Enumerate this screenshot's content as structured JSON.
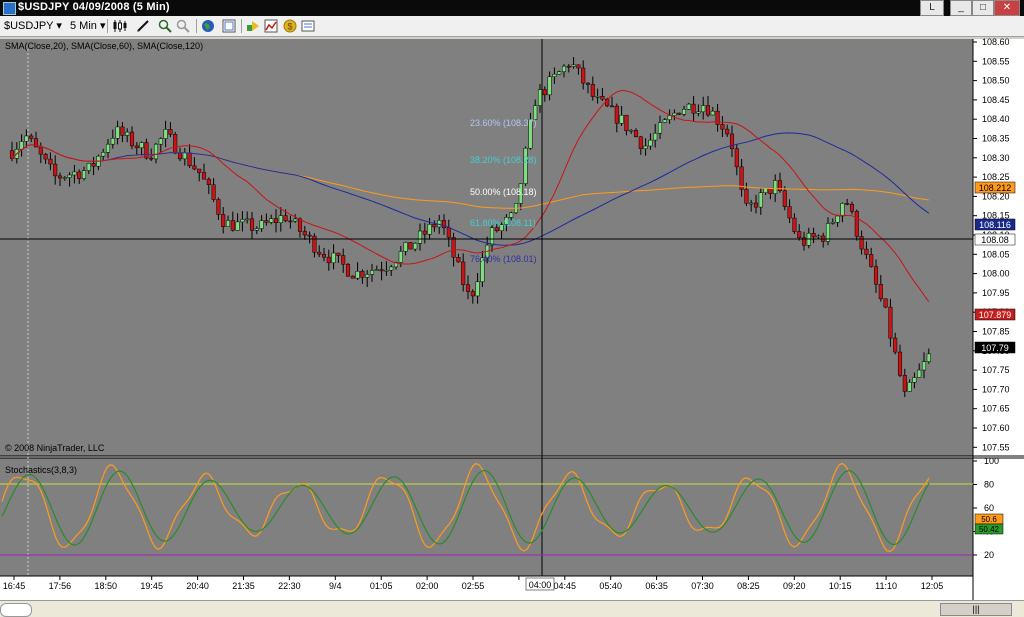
{
  "window": {
    "title": "$USDJPY  04/09/2008 (5 Min)",
    "btn_restore": "L",
    "btn_min": "_",
    "btn_max": "□",
    "btn_close": "✕"
  },
  "toolbar": {
    "instrument": "$USDJPY",
    "interval": "5 Min",
    "dropdown_glyph": "▾"
  },
  "icons": [
    "bar-type-icon",
    "drawing-tool-icon",
    "zoom-in-icon",
    "zoom-out-icon",
    "globe-icon",
    "properties-icon",
    "strategy-icon",
    "indicator-icon",
    "coin-icon",
    "data-box-icon"
  ],
  "main_panel": {
    "indicator_label": "SMA(Close,20), SMA(Close,60), SMA(Close,120)",
    "copyright": "© 2008 NinjaTrader, LLC",
    "y_ticks": [
      "108.60",
      "108.55",
      "108.50",
      "108.45",
      "108.40",
      "108.35",
      "108.30",
      "108.25",
      "108.20",
      "108.15",
      "108.10",
      "108.05",
      "108.00",
      "107.95",
      "107.90",
      "107.85",
      "107.80",
      "107.75",
      "107.70",
      "107.65",
      "107.60",
      "107.55"
    ],
    "price_tags": [
      {
        "label": "108.212",
        "color": "#ff9a1a",
        "text_color": "#000000"
      },
      {
        "label": "108.116",
        "color": "#1a2a8a",
        "text_color": "#ffffff"
      },
      {
        "label": "108.08",
        "color": "#ffffff",
        "text_color": "#000000"
      },
      {
        "label": "107.879",
        "color": "#c41e1e",
        "text_color": "#ffffff"
      },
      {
        "label": "107.79",
        "color": "#000000",
        "text_color": "#ffffff"
      }
    ],
    "fib_levels": [
      {
        "label": "23.60% (108.37)",
        "color": "#b0c8f0"
      },
      {
        "label": "38.20% (108.28)",
        "color": "#40d0d0"
      },
      {
        "label": "50.00% (108.18)",
        "color": "#ffffff"
      },
      {
        "label": "61.80% (108.11)",
        "color": "#40d0d0"
      },
      {
        "label": "76.40% (108.01)",
        "color": "#3030a0"
      }
    ]
  },
  "stoch_panel": {
    "label": "Stochastics(3,8,3)",
    "y_ticks": [
      "100",
      "80",
      "60",
      "40",
      "20"
    ],
    "tags": [
      {
        "label": "50.6",
        "color": "#ff9a1a"
      },
      {
        "label": "50.42",
        "color": "#2a9a2a"
      }
    ]
  },
  "x_ticks": [
    "16:45",
    "17:56",
    "18:50",
    "19:45",
    "20:40",
    "21:35",
    "22:30",
    "9/4",
    "01:05",
    "02:00",
    "02:55",
    "04:00",
    "04:45",
    "05:40",
    "06:35",
    "07:30",
    "08:25",
    "09:20",
    "10:15",
    "11:10",
    "12:05"
  ],
  "cursor_time": "04:00",
  "colors": {
    "background": "#808080",
    "bull": "#7ee07e",
    "bear": "#c81414",
    "sma20": "#c81414",
    "sma60": "#1c2a9c",
    "sma120": "#ff9a1a",
    "stoch_k": "#ff9a1a",
    "stoch_d": "#2a8a2a",
    "overbought": "#c8e040",
    "oversold": "#a020c0"
  }
}
